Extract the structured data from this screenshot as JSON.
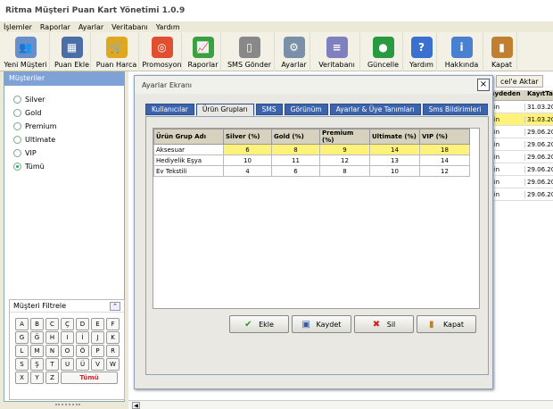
{
  "app": {
    "title": "Ritma Müşteri Puan Kart Yönetimi 1.0.9"
  },
  "menu": [
    "İşlemler",
    "Raporlar",
    "Ayarlar",
    "Veritabanı",
    "Yardım"
  ],
  "toolbar": [
    {
      "label": "Yeni Müşteri",
      "icon": "users-icon",
      "color": "#6a8ec8"
    },
    {
      "label": "Puan Ekle",
      "icon": "calculator-icon",
      "color": "#4a6fa8"
    },
    {
      "label": "Puan Harca",
      "icon": "basket-icon",
      "color": "#e0a820"
    },
    {
      "label": "Promosyon",
      "icon": "target-icon",
      "color": "#e05030"
    },
    {
      "label": "Raporlar",
      "icon": "chart-icon",
      "color": "#3aa040"
    },
    {
      "label": "SMS Gönder",
      "icon": "phone-icon",
      "color": "#888888"
    },
    {
      "label": "Ayarlar",
      "icon": "gear-icon",
      "color": "#7a8fa8"
    },
    {
      "label": "Veritabanı",
      "icon": "database-icon",
      "color": "#8080c0"
    },
    {
      "label": "Güncelle",
      "icon": "globe-icon",
      "color": "#2a9a40"
    },
    {
      "label": "Yardım",
      "icon": "help-icon",
      "color": "#3a70d0"
    },
    {
      "label": "Hakkında",
      "icon": "info-icon",
      "color": "#4a80d0"
    },
    {
      "label": "Kapat",
      "icon": "door-icon",
      "color": "#c08030"
    }
  ],
  "sidebar": {
    "header": "Müşteriler",
    "options": [
      {
        "label": "Silver",
        "selected": false
      },
      {
        "label": "Gold",
        "selected": false
      },
      {
        "label": "Premium",
        "selected": false
      },
      {
        "label": "Ultimate",
        "selected": false
      },
      {
        "label": "VIP",
        "selected": false
      },
      {
        "label": "Tümü",
        "selected": true
      }
    ]
  },
  "filter": {
    "title": "Müşteri Filtrele",
    "keys": [
      "A",
      "B",
      "C",
      "Ç",
      "D",
      "E",
      "F",
      "G",
      "Ğ",
      "H",
      "I",
      "İ",
      "J",
      "K",
      "L",
      "M",
      "N",
      "O",
      "Ö",
      "P",
      "R",
      "S",
      "Ş",
      "T",
      "U",
      "Ü",
      "V",
      "W",
      "X",
      "Y",
      "Z"
    ],
    "all_label": "Tümü"
  },
  "background": {
    "export_button": "cel'e Aktar",
    "columns": [
      "aydeden",
      "KayıtTa"
    ],
    "rows": [
      {
        "c1": "sin",
        "c2": "31.03.20",
        "selected": false
      },
      {
        "c1": "sin",
        "c2": "31.03.20",
        "selected": true
      },
      {
        "c1": "sin",
        "c2": "29.06.20",
        "selected": false
      },
      {
        "c1": "sin",
        "c2": "29.06.20",
        "selected": false
      },
      {
        "c1": "sin",
        "c2": "29.06.20",
        "selected": false
      },
      {
        "c1": "sin",
        "c2": "29.06.20",
        "selected": false
      },
      {
        "c1": "sin",
        "c2": "29.06.20",
        "selected": false
      },
      {
        "c1": "sin",
        "c2": "29.06.20",
        "selected": false
      }
    ]
  },
  "dialog": {
    "title": "Ayarlar Ekranı",
    "close": "×",
    "tabs": [
      {
        "label": "Kullanıcılar",
        "active": false
      },
      {
        "label": "Ürün Grupları",
        "active": true
      },
      {
        "label": "SMS",
        "active": false
      },
      {
        "label": "Görünüm",
        "active": false
      },
      {
        "label": "Ayarlar & Üye Tanımları",
        "active": false
      },
      {
        "label": "Sms Bildirimleri",
        "active": false
      }
    ],
    "table": {
      "columns": [
        "Ürün Grup Adı",
        "Silver (%)",
        "Gold (%)",
        "Premium (%)",
        "Ultimate (%)",
        "VIP (%)"
      ],
      "rows": [
        [
          "Aksesuar",
          "6",
          "8",
          "9",
          "14",
          "18"
        ],
        [
          "Hediyelik Eşya",
          "10",
          "11",
          "12",
          "13",
          "14"
        ],
        [
          "Ev Tekstili",
          "4",
          "6",
          "8",
          "10",
          "12"
        ]
      ],
      "selected_row": 0
    },
    "buttons": [
      {
        "label": "Ekle",
        "icon": "check-icon",
        "color": "#2a9a30"
      },
      {
        "label": "Kaydet",
        "icon": "save-icon",
        "color": "#3a5aa8"
      },
      {
        "label": "Sil",
        "icon": "delete-icon",
        "color": "#d02020"
      },
      {
        "label": "Kapat",
        "icon": "door-icon",
        "color": "#c08030"
      }
    ]
  }
}
